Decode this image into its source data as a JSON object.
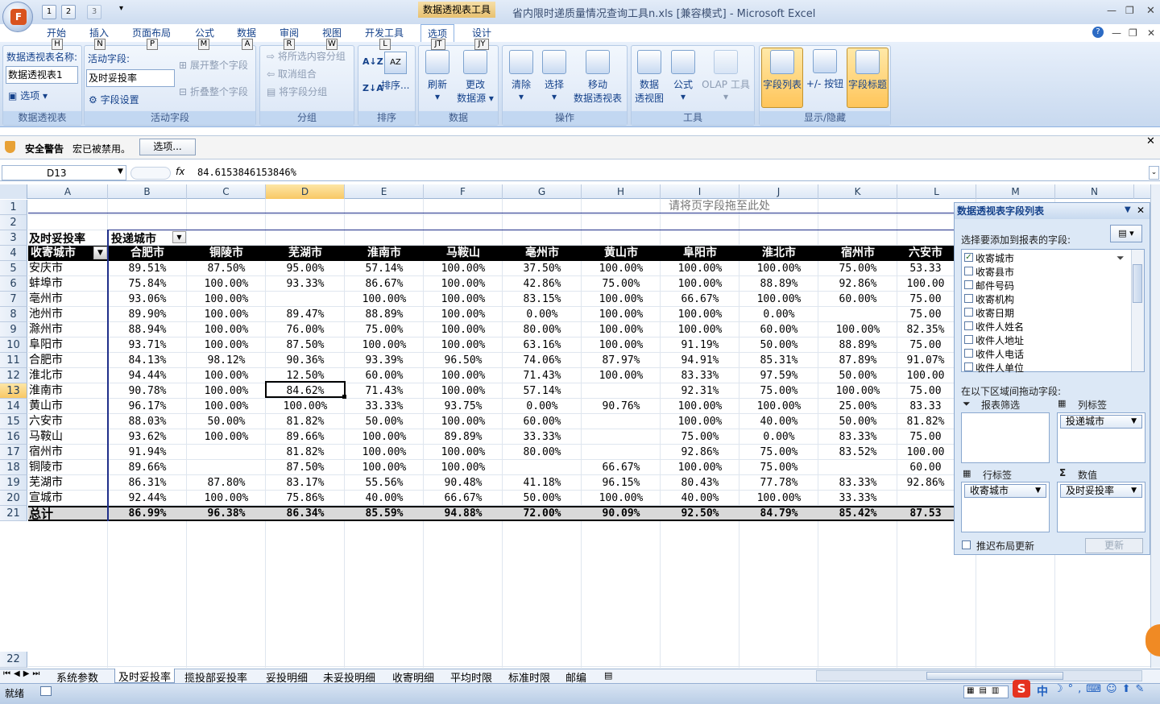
{
  "title_bar": {
    "context_tab_group": "数据透视表工具",
    "window_title": "省内限时递质量情况查询工具n.xls  [兼容模式] - Microsoft Excel",
    "office_letter": "F",
    "qat_keys": [
      "1",
      "2",
      "3"
    ]
  },
  "ribbon_tabs": [
    {
      "label": "开始",
      "key": "H"
    },
    {
      "label": "插入",
      "key": "N"
    },
    {
      "label": "页面布局",
      "key": "P"
    },
    {
      "label": "公式",
      "key": "M"
    },
    {
      "label": "数据",
      "key": "A"
    },
    {
      "label": "审阅",
      "key": "R"
    },
    {
      "label": "视图",
      "key": "W"
    },
    {
      "label": "开发工具",
      "key": "L"
    },
    {
      "label": "选项",
      "key": "JT"
    },
    {
      "label": "设计",
      "key": "JY"
    }
  ],
  "ribbon": {
    "pivot_name_label": "数据透视表名称:",
    "pivot_name_value": "数据透视表1",
    "options_label": "选项",
    "group_pivot": "数据透视表",
    "active_field_label": "活动字段:",
    "active_field_value": "及时妥投率",
    "field_settings": "字段设置",
    "expand_field": "展开整个字段",
    "collapse_field": "折叠整个字段",
    "group_active_field": "活动字段",
    "group_selection": "将所选内容分组",
    "ungroup": "取消组合",
    "group_field": "将字段分组",
    "group_group": "分组",
    "sort": "排序...",
    "group_sort": "排序",
    "refresh": "刷新",
    "change_source_1": "更改",
    "change_source_2": "数据源",
    "group_data": "数据",
    "clear": "清除",
    "select": "选择",
    "move_1": "移动",
    "move_2": "数据透视表",
    "group_actions": "操作",
    "pivot_chart_1": "数据",
    "pivot_chart_2": "透视图",
    "formulas": "公式",
    "olap": "OLAP 工具",
    "group_tools": "工具",
    "field_list": "字段列表",
    "buttons": "+/- 按钮",
    "field_headers": "字段标题",
    "group_show_hide": "显示/隐藏"
  },
  "security": {
    "label": "安全警告",
    "message": "宏已被禁用。",
    "button": "选项..."
  },
  "formula_bar": {
    "name_box": "D13",
    "fx": "fx",
    "value": "84.6153846153846%"
  },
  "columns": [
    "A",
    "B",
    "C",
    "D",
    "E",
    "F",
    "G",
    "H",
    "I",
    "J",
    "K",
    "L",
    "M",
    "N"
  ],
  "rows": [
    "1",
    "2",
    "3",
    "4",
    "5",
    "6",
    "7",
    "8",
    "9",
    "10",
    "11",
    "12",
    "13",
    "14",
    "15",
    "16",
    "17",
    "18",
    "19",
    "20",
    "21",
    "22"
  ],
  "page_field_hint": "请将页字段拖至此处",
  "pivot": {
    "value_label": "及时妥投率",
    "col_field": "投递城市",
    "row_field": "收寄城市",
    "col_headers": [
      "合肥市",
      "铜陵市",
      "芜湖市",
      "淮南市",
      "马鞍山",
      "亳州市",
      "黄山市",
      "阜阳市",
      "淮北市",
      "宿州市",
      "六安市"
    ],
    "rows": [
      {
        "city": "安庆市",
        "v": [
          "89.51%",
          "87.50%",
          "95.00%",
          "57.14%",
          "100.00%",
          "37.50%",
          "100.00%",
          "100.00%",
          "100.00%",
          "75.00%",
          "53.33"
        ]
      },
      {
        "city": "蚌埠市",
        "v": [
          "75.84%",
          "100.00%",
          "93.33%",
          "86.67%",
          "100.00%",
          "42.86%",
          "75.00%",
          "100.00%",
          "88.89%",
          "92.86%",
          "100.00"
        ]
      },
      {
        "city": "亳州市",
        "v": [
          "93.06%",
          "100.00%",
          "",
          "100.00%",
          "100.00%",
          "83.15%",
          "100.00%",
          "66.67%",
          "100.00%",
          "60.00%",
          "75.00"
        ]
      },
      {
        "city": "池州市",
        "v": [
          "89.90%",
          "100.00%",
          "89.47%",
          "88.89%",
          "100.00%",
          "0.00%",
          "100.00%",
          "100.00%",
          "0.00%",
          "",
          "75.00"
        ]
      },
      {
        "city": "滁州市",
        "v": [
          "88.94%",
          "100.00%",
          "76.00%",
          "75.00%",
          "100.00%",
          "80.00%",
          "100.00%",
          "100.00%",
          "60.00%",
          "100.00%",
          "82.35%"
        ]
      },
      {
        "city": "阜阳市",
        "v": [
          "93.71%",
          "100.00%",
          "87.50%",
          "100.00%",
          "100.00%",
          "63.16%",
          "100.00%",
          "91.19%",
          "50.00%",
          "88.89%",
          "75.00"
        ]
      },
      {
        "city": "合肥市",
        "v": [
          "84.13%",
          "98.12%",
          "90.36%",
          "93.39%",
          "96.50%",
          "74.06%",
          "87.97%",
          "94.91%",
          "85.31%",
          "87.89%",
          "91.07%"
        ]
      },
      {
        "city": "淮北市",
        "v": [
          "94.44%",
          "100.00%",
          "12.50%",
          "60.00%",
          "100.00%",
          "71.43%",
          "100.00%",
          "83.33%",
          "97.59%",
          "50.00%",
          "100.00"
        ]
      },
      {
        "city": "淮南市",
        "v": [
          "90.78%",
          "100.00%",
          "84.62%",
          "71.43%",
          "100.00%",
          "57.14%",
          "",
          "92.31%",
          "75.00%",
          "100.00%",
          "75.00"
        ]
      },
      {
        "city": "黄山市",
        "v": [
          "96.17%",
          "100.00%",
          "100.00%",
          "33.33%",
          "93.75%",
          "0.00%",
          "90.76%",
          "100.00%",
          "100.00%",
          "25.00%",
          "83.33"
        ]
      },
      {
        "city": "六安市",
        "v": [
          "88.03%",
          "50.00%",
          "81.82%",
          "50.00%",
          "100.00%",
          "60.00%",
          "",
          "100.00%",
          "40.00%",
          "50.00%",
          "81.82%"
        ]
      },
      {
        "city": "马鞍山",
        "v": [
          "93.62%",
          "100.00%",
          "89.66%",
          "100.00%",
          "89.89%",
          "33.33%",
          "",
          "75.00%",
          "0.00%",
          "83.33%",
          "75.00"
        ]
      },
      {
        "city": "宿州市",
        "v": [
          "91.94%",
          "",
          "81.82%",
          "100.00%",
          "100.00%",
          "80.00%",
          "",
          "92.86%",
          "75.00%",
          "83.52%",
          "100.00"
        ]
      },
      {
        "city": "铜陵市",
        "v": [
          "89.66%",
          "",
          "87.50%",
          "100.00%",
          "100.00%",
          "",
          "66.67%",
          "100.00%",
          "75.00%",
          "",
          "60.00"
        ]
      },
      {
        "city": "芜湖市",
        "v": [
          "86.31%",
          "87.80%",
          "83.17%",
          "55.56%",
          "90.48%",
          "41.18%",
          "96.15%",
          "80.43%",
          "77.78%",
          "83.33%",
          "92.86%"
        ]
      },
      {
        "city": "宣城市",
        "v": [
          "92.44%",
          "100.00%",
          "75.86%",
          "40.00%",
          "66.67%",
          "50.00%",
          "100.00%",
          "40.00%",
          "100.00%",
          "33.33%",
          ""
        ]
      }
    ],
    "total_label": "总计",
    "totals": [
      "86.99%",
      "96.38%",
      "86.34%",
      "85.59%",
      "94.88%",
      "72.00%",
      "90.09%",
      "92.50%",
      "84.79%",
      "85.42%",
      "87.53"
    ]
  },
  "field_pane": {
    "title": "数据透视表字段列表",
    "choose_label": "选择要添加到报表的字段:",
    "fields": [
      {
        "name": "收寄城市",
        "checked": true
      },
      {
        "name": "收寄县市",
        "checked": false
      },
      {
        "name": "邮件号码",
        "checked": false
      },
      {
        "name": "收寄机构",
        "checked": false
      },
      {
        "name": "收寄日期",
        "checked": false
      },
      {
        "name": "收件人姓名",
        "checked": false
      },
      {
        "name": "收件人地址",
        "checked": false
      },
      {
        "name": "收件人电话",
        "checked": false
      },
      {
        "name": "收件人单位",
        "checked": false
      }
    ],
    "drag_label": "在以下区域间拖动字段:",
    "report_filter": "报表筛选",
    "column_labels": "列标签",
    "column_item": "投递城市",
    "row_labels": "行标签",
    "row_item": "收寄城市",
    "values": "数值",
    "values_item": "及时妥投率",
    "sigma": "Σ",
    "defer_label": "推迟布局更新",
    "update": "更新"
  },
  "sheet_tabs": [
    "系统参数",
    "及时妥投率",
    "揽投部妥投率",
    "妥投明细",
    "未妥投明细",
    "收寄明细",
    "平均时限",
    "标准时限",
    "邮编"
  ],
  "status": {
    "ready": "就绪",
    "ime": "中"
  }
}
